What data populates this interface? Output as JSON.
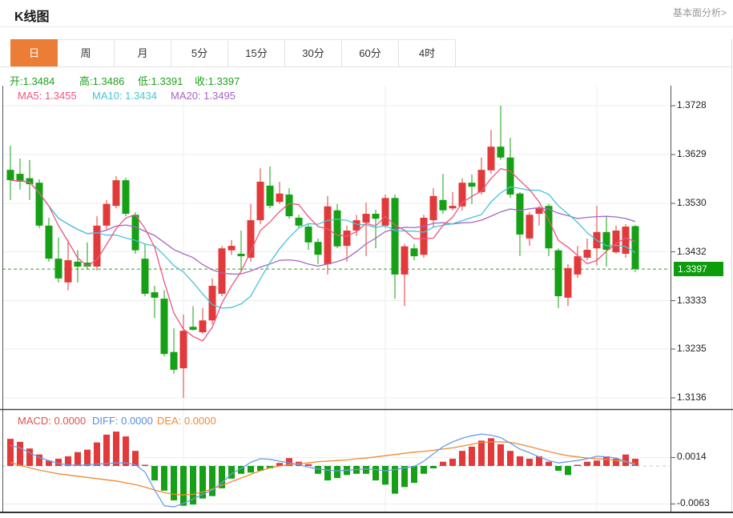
{
  "header": {
    "title": "K线图",
    "link": "基本面分析>"
  },
  "tabs": {
    "active": 0,
    "items": [
      {
        "key": "day",
        "label": "日"
      },
      {
        "key": "week",
        "label": "周"
      },
      {
        "key": "month",
        "label": "月"
      },
      {
        "key": "5min",
        "label": "5分"
      },
      {
        "key": "15min",
        "label": "15分"
      },
      {
        "key": "30min",
        "label": "30分"
      },
      {
        "key": "60min",
        "label": "60分"
      },
      {
        "key": "4hour",
        "label": "4时"
      }
    ]
  },
  "colors": {
    "up": "#e23a3a",
    "down": "#16a016",
    "ohlc_text": "#1ea11e",
    "tab_active_bg": "#ec7d36",
    "badge_bg": "#0c9c0c",
    "ma5": "#ec567c",
    "ma10": "#45c5d8",
    "ma20": "#a566c6",
    "macd_label": "#e0544e",
    "diff_line": "#6a9ce8",
    "dea_line": "#f08a33"
  },
  "ohlc_row": [
    {
      "key": "open",
      "label": "开",
      "value": "1.3484"
    },
    {
      "key": "high",
      "label": "高",
      "value": "1.3486"
    },
    {
      "key": "low",
      "label": "低",
      "value": "1.3391"
    },
    {
      "key": "close",
      "label": "收",
      "value": "1.3397"
    }
  ],
  "ma_row": [
    {
      "key": "ma5",
      "label": "MA5",
      "value": "1.3455",
      "color": "#ec567c"
    },
    {
      "key": "ma10",
      "label": "MA10",
      "value": "1.3434",
      "color": "#45c5d8"
    },
    {
      "key": "ma20",
      "label": "MA20",
      "value": "1.3495",
      "color": "#a566c6"
    }
  ],
  "macd_row": [
    {
      "key": "macd",
      "label": "MACD",
      "value": "0.0000",
      "color": "#e0544e"
    },
    {
      "key": "diff",
      "label": "DIFF",
      "value": "0.0000",
      "color": "#568ce0"
    },
    {
      "key": "dea",
      "label": "DEA",
      "value": "0.0000",
      "color": "#f08a33"
    }
  ],
  "chart_data": {
    "type": "candlestick",
    "title": "K线图",
    "up_means": "red = rising, green = falling (CN convention)",
    "y_axis_ticks": [
      "1.3728",
      "1.3629",
      "1.3530",
      "1.3432",
      "1.3333",
      "1.3235",
      "1.3136"
    ],
    "y_axis_values": [
      1.3728,
      1.3629,
      1.353,
      1.3432,
      1.3333,
      1.3235,
      1.3136
    ],
    "ylim": [
      1.3136,
      1.3728
    ],
    "last_price": 1.3397,
    "last_price_label": "1.3397",
    "ma_periods": [
      5,
      10,
      20
    ],
    "candles": [
      [
        1.3598,
        1.3647,
        1.3537,
        1.3577
      ],
      [
        1.359,
        1.3621,
        1.3558,
        1.3574
      ],
      [
        1.3581,
        1.3618,
        1.3537,
        1.3569
      ],
      [
        1.3572,
        1.3579,
        1.348,
        1.3485
      ],
      [
        1.3485,
        1.3501,
        1.3412,
        1.3418
      ],
      [
        1.3418,
        1.3461,
        1.337,
        1.3378
      ],
      [
        1.337,
        1.3456,
        1.3354,
        1.3415
      ],
      [
        1.3412,
        1.3435,
        1.337,
        1.3402
      ],
      [
        1.341,
        1.3451,
        1.3396,
        1.3402
      ],
      [
        1.3402,
        1.3504,
        1.3394,
        1.3485
      ],
      [
        1.3485,
        1.3537,
        1.3477,
        1.3529
      ],
      [
        1.3525,
        1.3585,
        1.352,
        1.3577
      ],
      [
        1.3577,
        1.3582,
        1.3504,
        1.3509
      ],
      [
        1.3507,
        1.3512,
        1.3428,
        1.3435
      ],
      [
        1.3418,
        1.3448,
        1.3342,
        1.3347
      ],
      [
        1.335,
        1.3363,
        1.3298,
        1.3339
      ],
      [
        1.3337,
        1.3354,
        1.322,
        1.3225
      ],
      [
        1.3229,
        1.3277,
        1.3185,
        1.3193
      ],
      [
        1.3196,
        1.3305,
        1.3136,
        1.3272
      ],
      [
        1.328,
        1.3322,
        1.3272,
        1.3274
      ],
      [
        1.3269,
        1.3318,
        1.3266,
        1.3293
      ],
      [
        1.3293,
        1.3378,
        1.3285,
        1.3363
      ],
      [
        1.3347,
        1.3444,
        1.3342,
        1.3439
      ],
      [
        1.3435,
        1.3456,
        1.3426,
        1.3444
      ],
      [
        1.3428,
        1.3475,
        1.3394,
        1.3423
      ],
      [
        1.342,
        1.3529,
        1.3412,
        1.3496
      ],
      [
        1.3496,
        1.3601,
        1.3488,
        1.3574
      ],
      [
        1.3566,
        1.3605,
        1.352,
        1.3525
      ],
      [
        1.3533,
        1.3574,
        1.3529,
        1.355
      ],
      [
        1.3548,
        1.3561,
        1.3499,
        1.3504
      ],
      [
        1.3501,
        1.3507,
        1.348,
        1.3485
      ],
      [
        1.3483,
        1.3488,
        1.3436,
        1.3451
      ],
      [
        1.3452,
        1.3459,
        1.3407,
        1.3426
      ],
      [
        1.3407,
        1.3545,
        1.3386,
        1.3524
      ],
      [
        1.3516,
        1.3529,
        1.3439,
        1.3443
      ],
      [
        1.3444,
        1.3485,
        1.3412,
        1.3475
      ],
      [
        1.3475,
        1.3507,
        1.3464,
        1.3496
      ],
      [
        1.3491,
        1.3532,
        1.3423,
        1.3509
      ],
      [
        1.3509,
        1.3517,
        1.3439,
        1.3499
      ],
      [
        1.3485,
        1.3548,
        1.348,
        1.3541
      ],
      [
        1.3541,
        1.3548,
        1.3337,
        1.3386
      ],
      [
        1.3386,
        1.3448,
        1.3322,
        1.3443
      ],
      [
        1.3439,
        1.3448,
        1.3415,
        1.3423
      ],
      [
        1.3426,
        1.3507,
        1.342,
        1.3501
      ],
      [
        1.3496,
        1.3561,
        1.3483,
        1.3545
      ],
      [
        1.3537,
        1.359,
        1.3509,
        1.3516
      ],
      [
        1.352,
        1.3553,
        1.3516,
        1.3525
      ],
      [
        1.3524,
        1.3581,
        1.3516,
        1.3572
      ],
      [
        1.3572,
        1.3589,
        1.3529,
        1.3564
      ],
      [
        1.3553,
        1.3623,
        1.3548,
        1.3598
      ],
      [
        1.3597,
        1.3679,
        1.359,
        1.3645
      ],
      [
        1.3645,
        1.3728,
        1.3618,
        1.3623
      ],
      [
        1.3623,
        1.3663,
        1.3541,
        1.3548
      ],
      [
        1.355,
        1.3553,
        1.3423,
        1.3467
      ],
      [
        1.3459,
        1.3512,
        1.3444,
        1.3507
      ],
      [
        1.3509,
        1.3525,
        1.3485,
        1.352
      ],
      [
        1.3525,
        1.3529,
        1.3423,
        1.3439
      ],
      [
        1.3435,
        1.3439,
        1.3318,
        1.3342
      ],
      [
        1.3339,
        1.3407,
        1.3322,
        1.3399
      ],
      [
        1.3386,
        1.3444,
        1.3379,
        1.3423
      ],
      [
        1.342,
        1.3459,
        1.3415,
        1.3436
      ],
      [
        1.3439,
        1.3525,
        1.3404,
        1.3472
      ],
      [
        1.3472,
        1.3504,
        1.3402,
        1.3436
      ],
      [
        1.3431,
        1.3485,
        1.3428,
        1.3475
      ],
      [
        1.3428,
        1.3488,
        1.342,
        1.3483
      ],
      [
        1.3484,
        1.3486,
        1.3391,
        1.3397
      ]
    ],
    "macd": {
      "y_ticks": [
        "0.0014",
        "-0.0063"
      ],
      "y_tick_values": [
        0.0014,
        -0.0063
      ],
      "hist": [
        0.0045,
        0.004,
        0.0029,
        0.0019,
        0.0009,
        0.0012,
        0.0016,
        0.0023,
        0.0027,
        0.0039,
        0.0052,
        0.0057,
        0.0049,
        0.0025,
        0.0002,
        -0.0024,
        -0.0041,
        -0.0057,
        -0.0066,
        -0.0064,
        -0.0054,
        -0.005,
        -0.0037,
        -0.0021,
        -0.0013,
        -0.0011,
        -0.0008,
        -0.0004,
        0.0005,
        0.0013,
        0.0007,
        0.0003,
        -0.0013,
        -0.0024,
        -0.002,
        -0.0015,
        -0.0013,
        -0.0013,
        -0.0024,
        -0.0031,
        -0.0046,
        -0.0035,
        -0.0028,
        -0.0013,
        -0.0004,
        0.0007,
        0.0012,
        0.0025,
        0.0032,
        0.0042,
        0.0046,
        0.0036,
        0.0025,
        0.0016,
        0.0012,
        0.0016,
        0.0007,
        -0.0008,
        -0.0015,
        0.0002,
        0.0007,
        0.0009,
        0.0016,
        0.0012,
        0.0019,
        0.0012
      ],
      "diff": [
        0.0034,
        0.003,
        0.0022,
        0.0014,
        0.0009,
        0.0004,
        0.0002,
        0.0001,
        0.0002,
        0.0003,
        0.0004,
        0.0005,
        0.0005,
        0.0002,
        -0.001,
        -0.004,
        -0.0066,
        -0.0068,
        -0.0062,
        -0.0055,
        -0.0047,
        -0.004,
        -0.0028,
        -0.0013,
        -0.0004,
        0.0006,
        0.0012,
        0.0011,
        0.0008,
        0.0005,
        0.0002,
        -0.0002,
        -0.0005,
        -0.0007,
        -0.0008,
        -0.0007,
        -0.0006,
        -0.0005,
        -0.0006,
        -0.0008,
        -0.0006,
        -0.0003,
        -0.0001,
        0.0008,
        0.002,
        0.0032,
        0.004,
        0.0046,
        0.005,
        0.0053,
        0.0051,
        0.0047,
        0.0038,
        0.0028,
        0.0022,
        0.0015,
        0.0009,
        0.0005,
        0.0007,
        0.0009,
        0.0012,
        0.0016,
        0.0015,
        0.0013,
        0.0008,
        0.0001
      ],
      "dea": [
        0.0006,
        0.0001,
        -0.0003,
        -0.0007,
        -0.001,
        -0.0013,
        -0.0015,
        -0.0017,
        -0.0019,
        -0.0021,
        -0.0023,
        -0.0025,
        -0.0028,
        -0.0031,
        -0.0035,
        -0.004,
        -0.0044,
        -0.0047,
        -0.0048,
        -0.0047,
        -0.0043,
        -0.0038,
        -0.0032,
        -0.0026,
        -0.002,
        -0.0014,
        -0.0008,
        -0.0003,
        0.0,
        0.0002,
        0.0004,
        0.0005,
        0.0007,
        0.0008,
        0.0009,
        0.001,
        0.0012,
        0.0013,
        0.0015,
        0.0017,
        0.0019,
        0.0021,
        0.0023,
        0.0024,
        0.0026,
        0.0028,
        0.003,
        0.0033,
        0.0036,
        0.0039,
        0.004,
        0.004,
        0.0039,
        0.0036,
        0.0032,
        0.0028,
        0.0024,
        0.002,
        0.0017,
        0.0015,
        0.0013,
        0.0012,
        0.0011,
        0.0009,
        0.0007,
        0.0004
      ]
    }
  }
}
